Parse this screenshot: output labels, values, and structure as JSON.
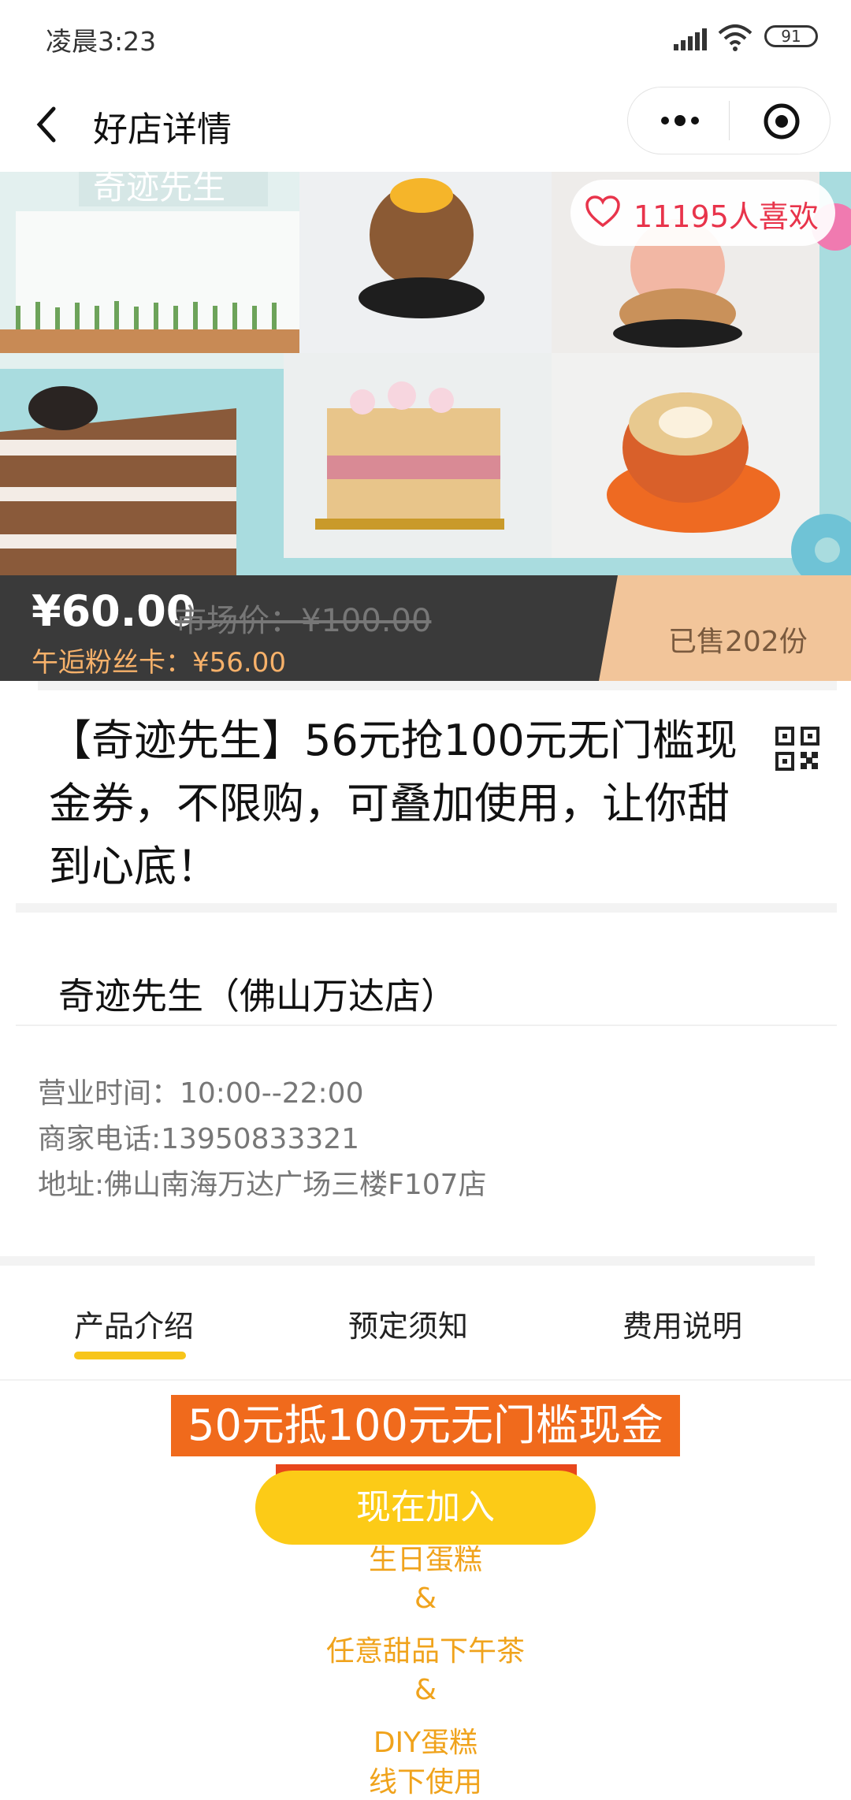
{
  "status": {
    "time": "凌晨3:23",
    "battery": "91"
  },
  "nav": {
    "title": "好店详情"
  },
  "hero": {
    "shop_sign": "奇迹先生",
    "likes": "11195人喜欢"
  },
  "price_bar": {
    "price": "¥60.00",
    "market_price": "市场价：¥100.00",
    "fan_price": "午逅粉丝卡：¥56.00",
    "sold": "已售202份"
  },
  "product": {
    "title": "【奇迹先生】56元抢100元无门槛现金券，不限购，可叠加使用，让你甜到心底！"
  },
  "shop": {
    "name": "奇迹先生（佛山万达店）",
    "hours": "营业时间：10:00--22:00",
    "phone": "商家电话:13950833321",
    "address": "地址:佛山南海万达广场三楼F107店"
  },
  "tabs": [
    {
      "label": "产品介绍",
      "active": true
    },
    {
      "label": "预定须知",
      "active": false
    },
    {
      "label": "费用说明",
      "active": false
    }
  ],
  "content": {
    "banner": "50元抵100元无门槛现金券",
    "lines": [
      "生日蛋糕",
      "&",
      "任意甜品下午茶",
      "&",
      "DIY蛋糕",
      "线下使用"
    ]
  },
  "cta": {
    "join_label": "现在加入"
  },
  "colors": {
    "accent_yellow": "#fccb17",
    "like_red": "#e8344b",
    "promo_orange": "#f06a1c",
    "text_orange": "#f0a31c"
  }
}
